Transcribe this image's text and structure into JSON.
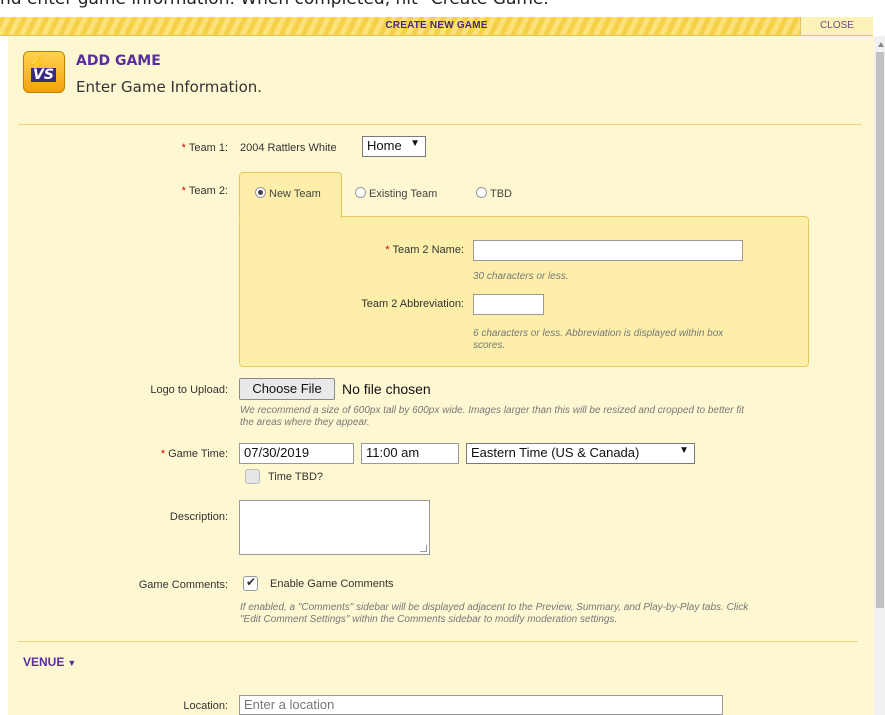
{
  "instruction_text": "nd enter game information. When completed, hit \"Create Game.\"",
  "titlebar": {
    "title": "CREATE NEW GAME",
    "close_label": "CLOSE"
  },
  "header": {
    "logo_text": "VS",
    "title": "ADD GAME",
    "subtitle": "Enter Game Information."
  },
  "team1": {
    "label": "Team 1:",
    "value": "2004 Rattlers White",
    "side_selected": "Home"
  },
  "team2": {
    "label": "Team 2:",
    "tabs": [
      {
        "label": "New Team",
        "selected": true
      },
      {
        "label": "Existing Team",
        "selected": false
      },
      {
        "label": "TBD",
        "selected": false
      }
    ],
    "name_label": "Team 2 Name:",
    "name_value": "",
    "name_hint": "30 characters or less.",
    "abbr_label": "Team 2 Abbreviation:",
    "abbr_value": "",
    "abbr_hint_line1": "6 characters or less. Abbreviation is displayed within box",
    "abbr_hint_line2": "scores."
  },
  "logo_upload": {
    "label": "Logo to Upload:",
    "button_label": "Choose File",
    "status": "No file chosen",
    "hint_line1": "We recommend a size of 600px tall by 600px wide. Images larger than this will be resized and cropped to better fit",
    "hint_line2": "the areas where they appear."
  },
  "game_time": {
    "label": "Game Time:",
    "date": "07/30/2019",
    "time": "11:00 am",
    "timezone": "Eastern Time (US & Canada)",
    "tbd_label": "Time TBD?",
    "tbd_checked": false
  },
  "description": {
    "label": "Description:",
    "value": ""
  },
  "comments": {
    "label": "Game Comments:",
    "checkbox_label": "Enable Game Comments",
    "checked": true,
    "hint_line1": "If enabled, a \"Comments\" sidebar will be displayed adjacent to the Preview, Summary, and Play-by-Play tabs. Click",
    "hint_line2": "\"Edit Comment Settings\" within the Comments sidebar to modify moderation settings."
  },
  "venue": {
    "label": "VENUE"
  },
  "location": {
    "label": "Location:",
    "placeholder": "Enter a location"
  },
  "colors": {
    "accent": "#5a2d9e",
    "panel": "#fef8d2",
    "tab": "#fdefaa",
    "required": "#dd0000"
  }
}
